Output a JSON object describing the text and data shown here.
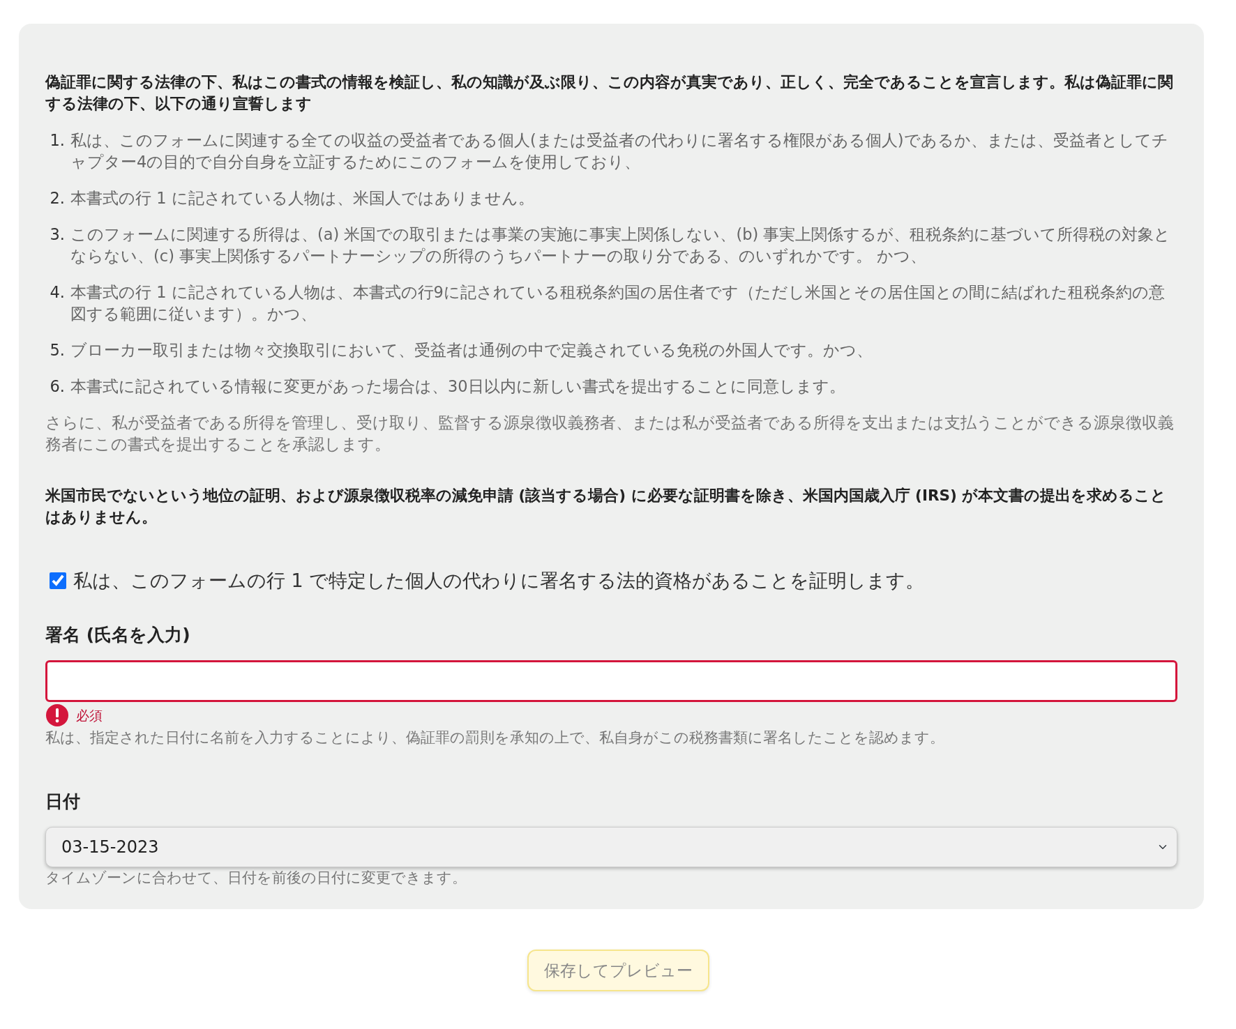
{
  "declaration": {
    "heading": "偽証罪に関する法律の下、私はこの書式の情報を検証し、私の知識が及ぶ限り、この内容が真実であり、正しく、完全であることを宣言します。私は偽証罪に関する法律の下、以下の通り宣誓します",
    "items": [
      {
        "number": "1.",
        "text": "私は、このフォームに関連する全ての収益の受益者である個人(または受益者の代わりに署名する権限がある個人)であるか、または、受益者としてチャプター4の目的で自分自身を立証するためにこのフォームを使用しており、"
      },
      {
        "number": "2.",
        "text": "本書式の行 1 に記されている人物は、米国人ではありません。"
      },
      {
        "number": "3.",
        "text": "このフォームに関連する所得は、(a) 米国での取引または事業の実施に事実上関係しない、(b) 事実上関係するが、租税条約に基づいて所得税の対象とならない、(c) 事実上関係するパートナーシップの所得のうちパートナーの取り分である、のいずれかです。 かつ、"
      },
      {
        "number": "4.",
        "text": "本書式の行 1 に記されている人物は、本書式の行9に記されている租税条約国の居住者です（ただし米国とその居住国との間に結ばれた租税条約の意図する範囲に従います）。かつ、"
      },
      {
        "number": "5.",
        "text": "ブローカー取引または物々交換取引において、受益者は通例の中で定義されている免税の外国人です。かつ、"
      },
      {
        "number": "6.",
        "text": "本書式に記されている情報に変更があった場合は、30日以内に新しい書式を提出することに同意します。"
      }
    ],
    "authorization": "さらに、私が受益者である所得を管理し、受け取り、監督する源泉徴収義務者、または私が受益者である所得を支出または支払うことができる源泉徴収義務者にこの書式を提出することを承認します。",
    "notice": "米国市民でないという地位の証明、および源泉徴収税率の減免申請 (該当する場合) に必要な証明書を除き、米国内国歳入庁 (IRS) が本文書の提出を求めることはありません。"
  },
  "capacity_checkbox": {
    "label": "私は、このフォームの行 1 で特定した個人の代わりに署名する法的資格があることを証明します。",
    "checked": true
  },
  "signature": {
    "label": "署名 (氏名を入力)",
    "invalid": true,
    "error": "必須",
    "help": "私は、指定された日付に名前を入力することにより、偽証罪の罰則を承知の上で、私自身がこの税務書類に署名したことを認めます。"
  },
  "date": {
    "label": "日付",
    "value": "03-15-2023",
    "help": "タイムゾーンに合わせて、日付を前後の日付に変更できます。"
  },
  "save_button": {
    "label": "保存してプレビュー",
    "disabled": true
  }
}
